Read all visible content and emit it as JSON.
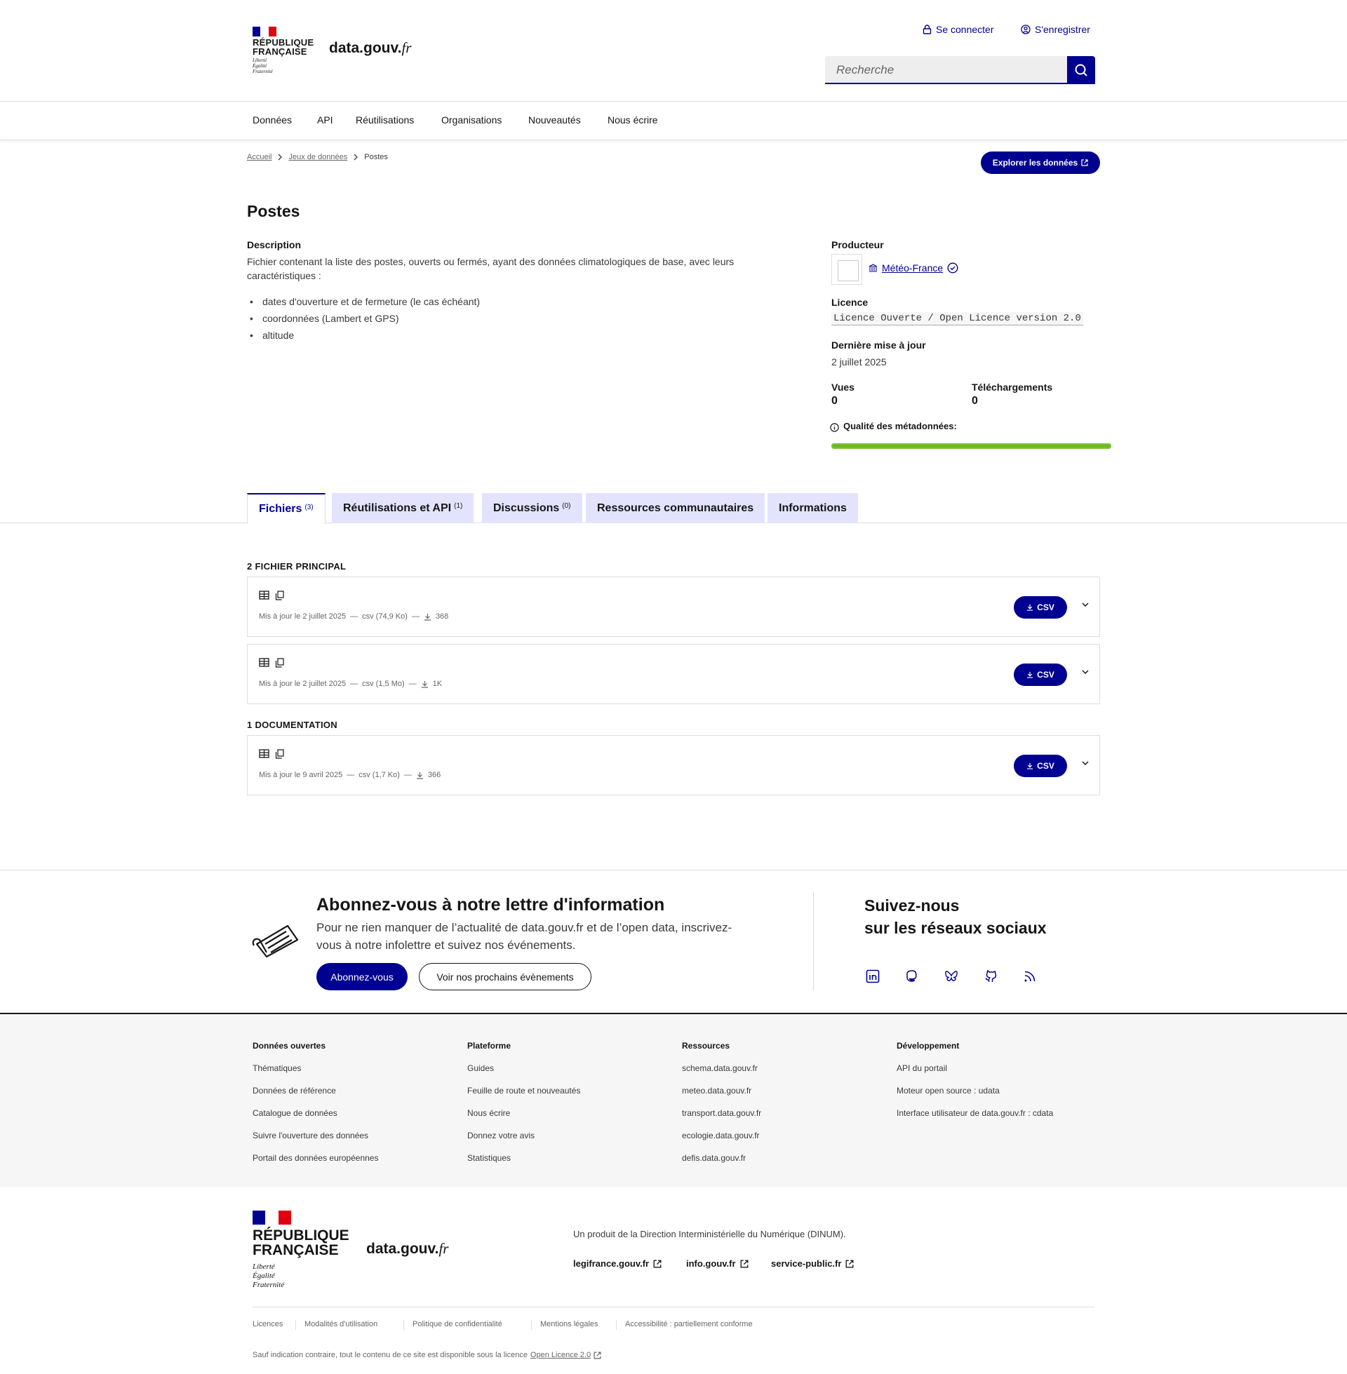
{
  "header": {
    "marianne_line1": "RÉPUBLIQUE",
    "marianne_line2": "FRANÇAISE",
    "motto1": "Liberté",
    "motto2": "Égalité",
    "motto3": "Fraternité",
    "site_name": "data.gouv.",
    "site_tld": "fr",
    "login": "Se connecter",
    "register": "S'enregistrer",
    "search_placeholder": "Recherche"
  },
  "nav": [
    "Données",
    "API",
    "Réutilisations",
    "Organisations",
    "Nouveautés",
    "Nous écrire"
  ],
  "breadcrumb": {
    "home": "Accueil",
    "datasets": "Jeux de données",
    "current": "Postes"
  },
  "explore_button": "Explorer les données",
  "dataset": {
    "title": "Postes",
    "description_label": "Description",
    "description": "Fichier contenant la liste des postes, ouverts ou fermés, ayant des données climatologiques de base, avec leurs caractéristiques :",
    "bullets": [
      "dates d'ouverture et de fermeture (le cas échéant)",
      "coordonnées (Lambert et GPS)",
      "altitude"
    ]
  },
  "sidebar": {
    "producer_label": "Producteur",
    "producer_name": "Météo-France",
    "licence_label": "Licence",
    "licence": "Licence Ouverte / Open Licence version 2.0",
    "updated_label": "Dernière mise à jour",
    "updated": "2 juillet 2025",
    "views_label": "Vues",
    "views": "0",
    "downloads_label": "Téléchargements",
    "downloads": "0",
    "quality_label": "Qualité des métadonnées:",
    "quality_fill": 1.0,
    "quality_color": "#6eb72a"
  },
  "tabs": [
    {
      "label": "Fichiers",
      "count": "(3)"
    },
    {
      "label": "Réutilisations et API",
      "count": "(1)"
    },
    {
      "label": "Discussions",
      "count": "(0)"
    },
    {
      "label": "Ressources communautaires",
      "count": ""
    },
    {
      "label": "Informations",
      "count": ""
    }
  ],
  "files": {
    "main_section": "2 FICHIER PRINCIPAL",
    "doc_section": "1 DOCUMENTATION",
    "items": [
      {
        "updated": "Mis à jour le 2 juillet 2025",
        "format": "csv (74,9 Ko)",
        "downloads": "368",
        "button": "CSV"
      },
      {
        "updated": "Mis à jour le 2 juillet 2025",
        "format": "csv (1,5 Mo)",
        "downloads": "1K",
        "button": "CSV"
      },
      {
        "updated": "Mis à jour le 9 avril 2025",
        "format": "csv (1,7 Ko)",
        "downloads": "366",
        "button": "CSV"
      }
    ],
    "separator": "—"
  },
  "newsletter": {
    "title": "Abonnez-vous à notre lettre d'information",
    "text": "Pour ne rien manquer de l’actualité de data.gouv.fr et de l’open data, inscrivez-vous à notre infolettre et suivez nos événements.",
    "subscribe": "Abonnez-vous",
    "events": "Voir nos prochains évènements",
    "social_title1": "Suivez-nous",
    "social_title2": "sur les réseaux sociaux"
  },
  "footer_links": [
    {
      "title": "Données ouvertes",
      "links": [
        "Thématiques",
        "Données de référence",
        "Catalogue de données",
        "Suivre l'ouverture des données",
        "Portail des données européennes"
      ]
    },
    {
      "title": "Plateforme",
      "links": [
        "Guides",
        "Feuille de route et nouveautés",
        "Nous écrire",
        "Donnez votre avis",
        "Statistiques"
      ]
    },
    {
      "title": "Ressources",
      "links": [
        "schema.data.gouv.fr",
        "meteo.data.gouv.fr",
        "transport.data.gouv.fr",
        "ecologie.data.gouv.fr",
        "defis.data.gouv.fr"
      ]
    },
    {
      "title": "Développement",
      "links": [
        "API du portail",
        "Moteur open source : udata",
        "Interface utilisateur de data.gouv.fr : cdata"
      ]
    }
  ],
  "bottom_footer": {
    "desc": "Un produit de la Direction Interministérielle du Numérique (DINUM).",
    "ext_links": [
      "legifrance.gouv.fr",
      "info.gouv.fr",
      "service-public.fr"
    ],
    "legal": [
      "Licences",
      "Modalités d'utilisation",
      "Politique de confidentialité",
      "Mentions légales",
      "Accessibilité : partiellement conforme"
    ],
    "licence_text": "Sauf indication contraire, tout le contenu de ce site est disponible sous la licence",
    "licence_link": "Open Licence 2.0"
  },
  "colors": {
    "brand": "#000091",
    "tab_bg": "#e3e3fd",
    "flag_blue": "#000091",
    "flag_red": "#e1000f"
  }
}
